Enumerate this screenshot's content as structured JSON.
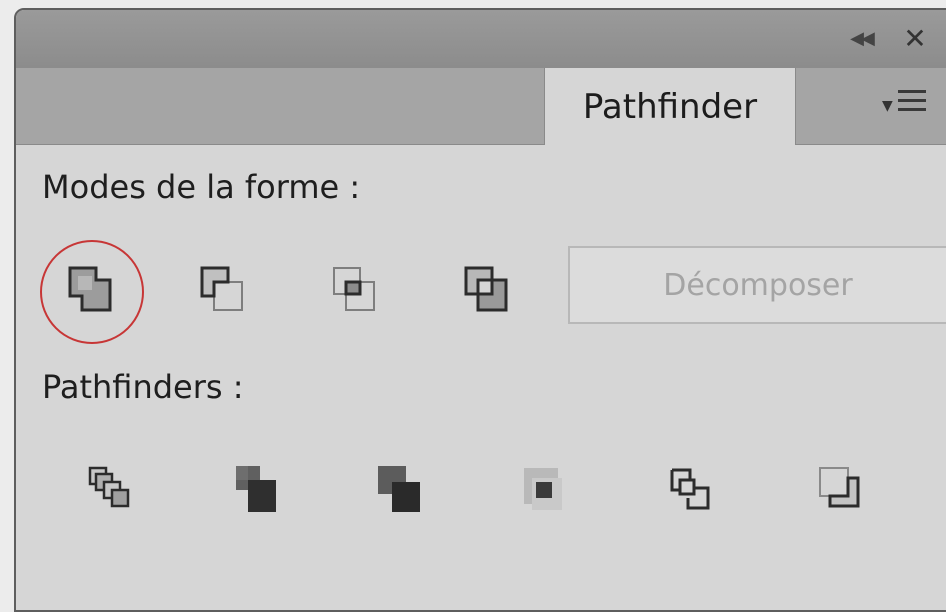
{
  "titlebar": {
    "collapse_icon": "double-chevron-left-icon",
    "close_icon": "close-icon"
  },
  "tabs": [
    {
      "label": "Pathfinder",
      "active": true
    }
  ],
  "panel_menu_icon": "panel-menu-icon",
  "shape_modes": {
    "label": "Modes de la forme :",
    "buttons": [
      {
        "icon": "unite-icon",
        "highlighted": true
      },
      {
        "icon": "minus-front-icon"
      },
      {
        "icon": "intersect-icon"
      },
      {
        "icon": "exclude-icon"
      }
    ],
    "expand_label": "Décomposer",
    "expand_enabled": false
  },
  "pathfinders": {
    "label": "Pathfinders :",
    "buttons": [
      {
        "icon": "divide-icon"
      },
      {
        "icon": "trim-icon"
      },
      {
        "icon": "merge-icon"
      },
      {
        "icon": "crop-icon"
      },
      {
        "icon": "outline-icon"
      },
      {
        "icon": "minus-back-icon"
      }
    ]
  },
  "colors": {
    "highlight_ring": "#c73636",
    "panel_bg": "#d6d6d6"
  }
}
